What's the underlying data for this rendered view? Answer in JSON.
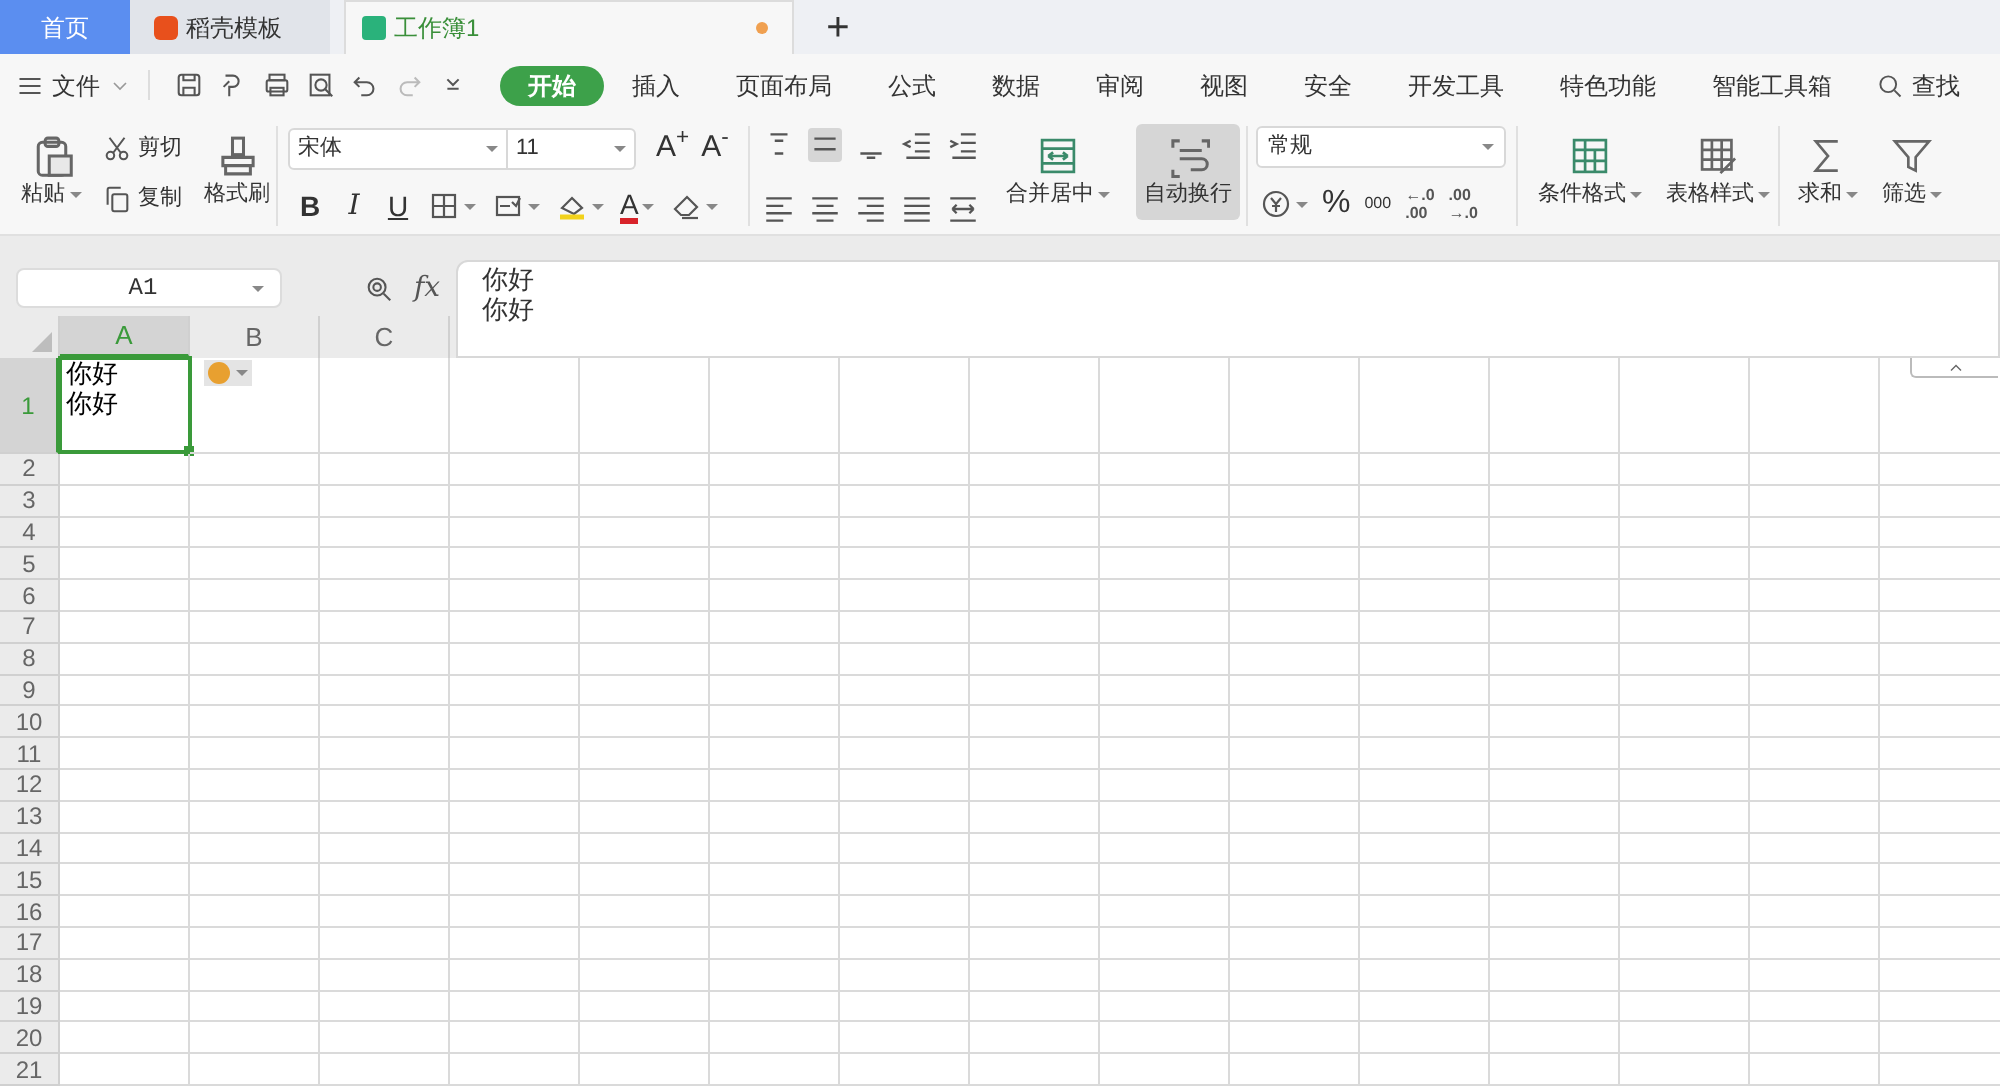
{
  "tabs": [
    {
      "label": "首页",
      "kind": "home",
      "selected": false
    },
    {
      "label": "稻壳模板",
      "kind": "docer",
      "selected": false
    },
    {
      "label": "工作簿1",
      "kind": "sheet",
      "selected": true,
      "unsaved": true
    }
  ],
  "new_tab": "+",
  "menu": {
    "file": "文件",
    "search": "查找",
    "items": [
      {
        "label": "开始",
        "selected": true
      },
      {
        "label": "插入",
        "selected": false
      },
      {
        "label": "页面布局",
        "selected": false
      },
      {
        "label": "公式",
        "selected": false
      },
      {
        "label": "数据",
        "selected": false
      },
      {
        "label": "审阅",
        "selected": false
      },
      {
        "label": "视图",
        "selected": false
      },
      {
        "label": "安全",
        "selected": false
      },
      {
        "label": "开发工具",
        "selected": false
      },
      {
        "label": "特色功能",
        "selected": false
      },
      {
        "label": "智能工具箱",
        "selected": false
      }
    ]
  },
  "ribbon": {
    "paste": "粘贴",
    "cut": "剪切",
    "copy": "复制",
    "format_painter": "格式刷",
    "font_name": "宋体",
    "font_size": "11",
    "grow_font": "A$^{+}$",
    "shrink_font": "A$^{-}$",
    "style_buttons": [
      {
        "label": "B",
        "kind": "bold"
      },
      {
        "label": "I",
        "kind": "italic"
      },
      {
        "label": "U",
        "kind": "underline"
      }
    ],
    "font_color": "A",
    "merge_center": "合并居中",
    "wrap_text": {
      "label": "自动换行",
      "pressed": true
    },
    "number_format": "常规",
    "percent": "%",
    "thousands": "000",
    "increase_decimal": [
      "←.0",
      ".00"
    ],
    "decrease_decimal": [
      ".00",
      "→.0"
    ],
    "conditional_format": "条件格式",
    "table_style": "表格样式",
    "sum": "求和",
    "filter": "筛选"
  },
  "name_box": "A1",
  "fx": "fx",
  "formula": [
    "你好",
    "你好"
  ],
  "grid": {
    "columns": [
      {
        "label": "A",
        "selected": true
      },
      {
        "label": "B",
        "selected": false
      },
      {
        "label": "C",
        "selected": false
      }
    ],
    "rows": [
      {
        "label": "1",
        "selected": true
      },
      {
        "label": "2",
        "selected": false
      },
      {
        "label": "3",
        "selected": false
      },
      {
        "label": "4",
        "selected": false
      },
      {
        "label": "5",
        "selected": false
      },
      {
        "label": "6",
        "selected": false
      },
      {
        "label": "7",
        "selected": false
      },
      {
        "label": "8",
        "selected": false
      },
      {
        "label": "9",
        "selected": false
      },
      {
        "label": "10",
        "selected": false
      },
      {
        "label": "11",
        "selected": false
      },
      {
        "label": "12",
        "selected": false
      },
      {
        "label": "13",
        "selected": false
      },
      {
        "label": "14",
        "selected": false
      },
      {
        "label": "15",
        "selected": false
      },
      {
        "label": "16",
        "selected": false
      },
      {
        "label": "17",
        "selected": false
      },
      {
        "label": "18",
        "selected": false
      },
      {
        "label": "19",
        "selected": false
      },
      {
        "label": "20",
        "selected": false
      },
      {
        "label": "21",
        "selected": false
      }
    ],
    "active_cell": [
      "你好",
      "你好"
    ]
  }
}
